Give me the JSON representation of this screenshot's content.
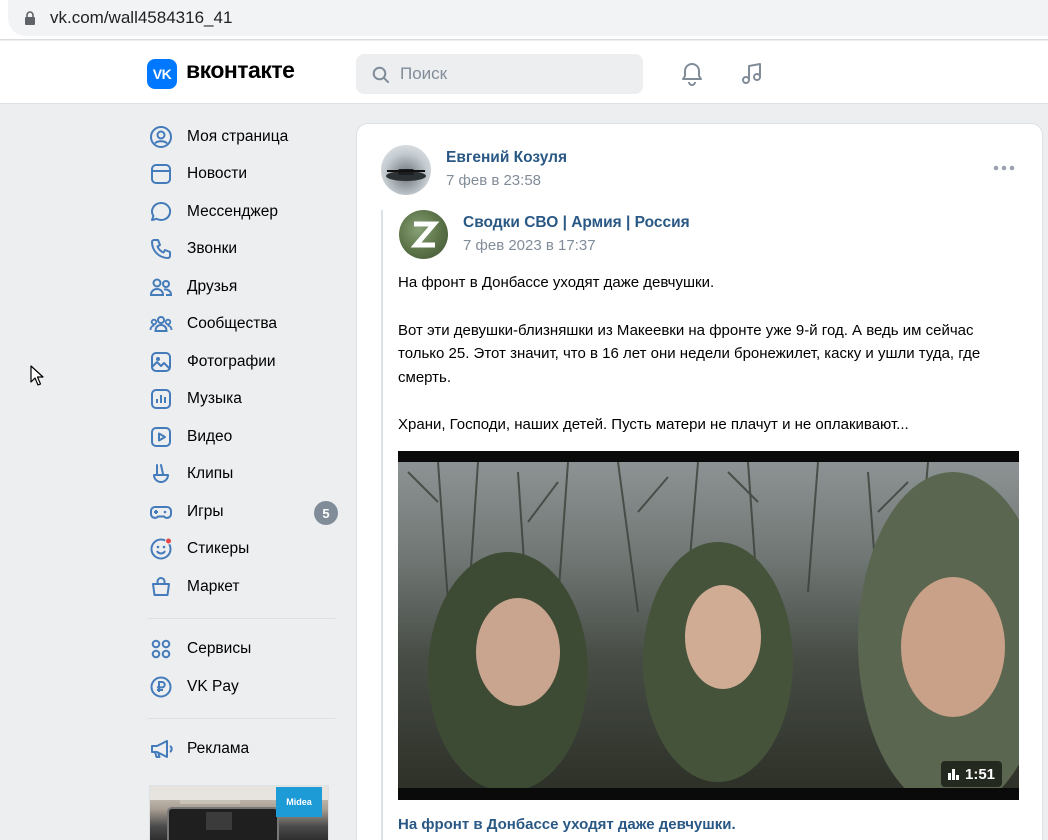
{
  "browser": {
    "url": "vk.com/wall4584316_41"
  },
  "header": {
    "logo_mark": "VK",
    "logo_text": "вконтакте",
    "search_placeholder": "Поиск",
    "accent": "#0077ff"
  },
  "sidebar": {
    "items": [
      {
        "label": "Моя страница",
        "icon": "user-circle-icon"
      },
      {
        "label": "Новости",
        "icon": "news-icon"
      },
      {
        "label": "Мессенджер",
        "icon": "message-icon"
      },
      {
        "label": "Звонки",
        "icon": "phone-icon"
      },
      {
        "label": "Друзья",
        "icon": "friends-icon"
      },
      {
        "label": "Сообщества",
        "icon": "communities-icon"
      },
      {
        "label": "Фотографии",
        "icon": "photo-icon"
      },
      {
        "label": "Музыка",
        "icon": "music-icon"
      },
      {
        "label": "Видео",
        "icon": "video-icon"
      },
      {
        "label": "Клипы",
        "icon": "clips-icon"
      },
      {
        "label": "Игры",
        "icon": "games-icon",
        "badge": "5"
      },
      {
        "label": "Стикеры",
        "icon": "stickers-icon"
      },
      {
        "label": "Маркет",
        "icon": "market-icon"
      }
    ],
    "extra": [
      {
        "label": "Сервисы",
        "icon": "services-icon"
      },
      {
        "label": "VK Pay",
        "icon": "vkpay-icon"
      }
    ],
    "ads": {
      "label": "Реклама",
      "icon": "megaphone-icon",
      "banner_brand": "Midea"
    }
  },
  "post": {
    "author": "Евгений Козуля",
    "date": "7 фев в 23:58",
    "repost": {
      "group": "Сводки СВО | Армия | Россия",
      "date": "7 фев 2023 в 17:37",
      "paragraphs": [
        "На фронт в Донбассе уходят даже девчушки.",
        "Вот эти девушки-близняшки из Макеевки на фронте уже 9-й год. А ведь им сейчас только 25. Этот значит, что в 16 лет они недели бронежилет, каску и ушли туда, где смерть.",
        "Храни, Господи, наших детей. Пусть матери не плачут и не оплакивают..."
      ],
      "video": {
        "duration": "1:51",
        "title": "На фронт в Донбассе уходят даже девчушки."
      }
    }
  }
}
